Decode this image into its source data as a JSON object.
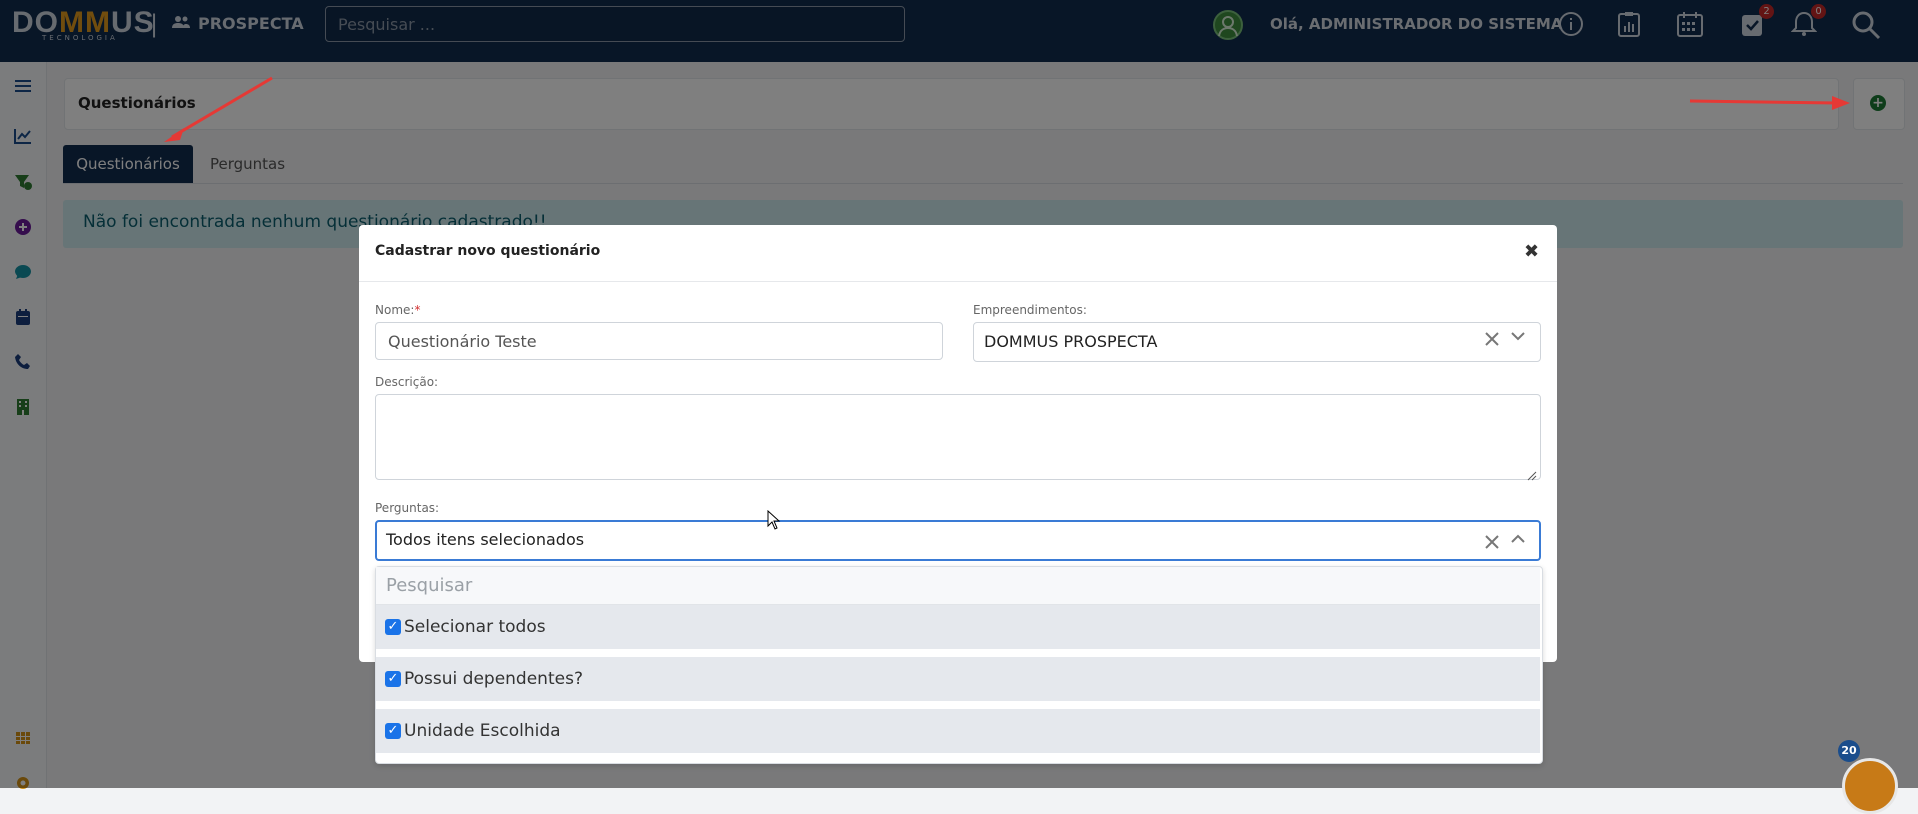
{
  "header": {
    "logo_main": "DO",
    "logo_mm": "MM",
    "logo_end": "US",
    "logo_sub": "TECNOLOGIA",
    "separator": "|",
    "brand": "PROSPECTA",
    "search_placeholder": "Pesquisar ...",
    "greeting": "Olá, ADMINISTRADOR DO SISTEMA",
    "tasks_badge": "2",
    "notifications_badge": "0"
  },
  "page": {
    "title": "Questionários",
    "tabs": [
      {
        "label": "Questionários",
        "active": true
      },
      {
        "label": "Perguntas",
        "active": false
      }
    ],
    "alert": "Não foi encontrada nenhum questionário cadastrado!!"
  },
  "modal": {
    "title": "Cadastrar novo questionário",
    "close": "✖",
    "nome_label": "Nome:",
    "nome_required": "*",
    "nome_value": "Questionário Teste",
    "emp_label": "Empreendimentos:",
    "emp_value": "DOMMUS PROSPECTA",
    "desc_label": "Descrição:",
    "perg_label": "Perguntas:",
    "perg_value": "Todos itens selecionados",
    "dropdown": {
      "search_placeholder": "Pesquisar",
      "options": [
        {
          "label": "Selecionar todos",
          "checked": true
        },
        {
          "label": "Possui dependentes?",
          "checked": true
        },
        {
          "label": "Unidade Escolhida",
          "checked": true
        }
      ]
    }
  },
  "call_widget": {
    "count": "20"
  },
  "colors": {
    "navbar": "#112c4e",
    "accent_orange": "#e39a1d",
    "add_green": "#1d7a34",
    "arrow_red": "#e53935"
  }
}
